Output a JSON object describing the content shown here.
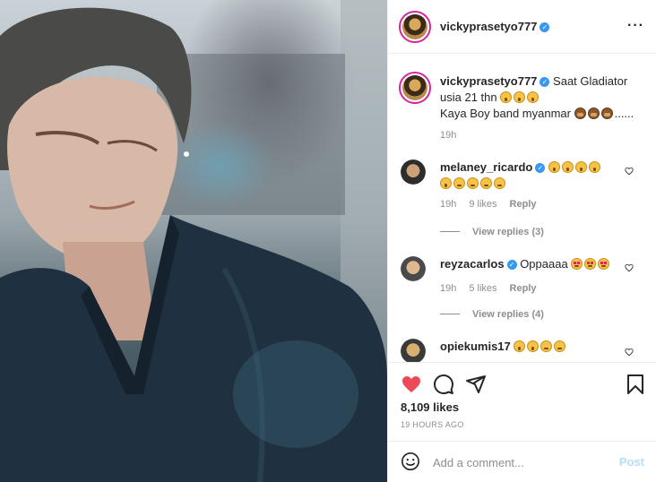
{
  "post": {
    "username": "vickyprasetyo777",
    "caption_line1": "Saat Gladiator",
    "caption_line2": "usia 21 thn",
    "caption_line3": "Kaya Boy band myanmar",
    "caption_tail": "......",
    "caption_time": "19h",
    "likes": "8,109 likes",
    "time_ago": "19 HOURS AGO"
  },
  "comments": [
    {
      "username": "melaney_ricardo",
      "time": "19h",
      "likes": "9 likes",
      "reply": "Reply",
      "view_replies": "View replies (3)"
    },
    {
      "username": "reyzacarlos",
      "text": "Oppaaaa",
      "time": "19h",
      "likes": "5 likes",
      "reply": "Reply",
      "view_replies": "View replies (4)"
    },
    {
      "username": "opiekumis17"
    }
  ],
  "add_comment": {
    "placeholder": "Add a comment...",
    "post_label": "Post"
  },
  "icons": [
    "verified-icon",
    "more-options-icon",
    "heart-icon",
    "comment-icon",
    "share-icon",
    "bookmark-icon",
    "emoji-icon"
  ],
  "colors": {
    "like_red": "#ed4956",
    "verified_blue": "#3897f0",
    "post_disabled": "#b2dffc",
    "secondary_text": "#8e8e8e"
  }
}
